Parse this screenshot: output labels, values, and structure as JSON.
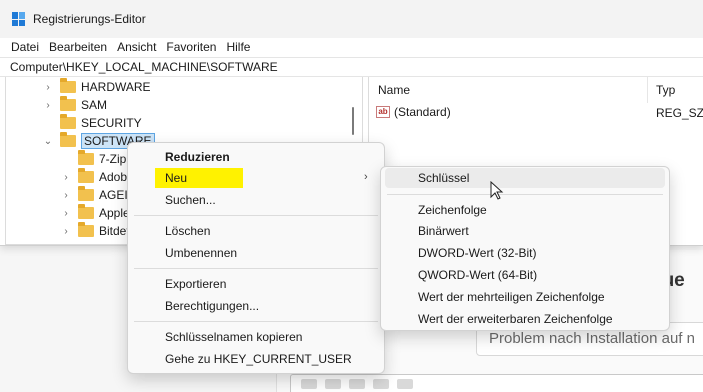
{
  "window": {
    "title": "Registrierungs-Editor",
    "menu": [
      "Datei",
      "Bearbeiten",
      "Ansicht",
      "Favoriten",
      "Hilfe"
    ],
    "address": "Computer\\HKEY_LOCAL_MACHINE\\SOFTWARE"
  },
  "tree": {
    "items": [
      {
        "label": "HARDWARE",
        "expander": "›"
      },
      {
        "label": "SAM",
        "expander": "›"
      },
      {
        "label": "SECURITY",
        "expander": ""
      },
      {
        "label": "SOFTWARE",
        "expander": "⌄",
        "selected": true
      },
      {
        "label": "7-Zip",
        "expander": ""
      },
      {
        "label": "Adobe",
        "expander": "›"
      },
      {
        "label": "AGEIA",
        "expander": "›"
      },
      {
        "label": "Apple",
        "expander": "›"
      },
      {
        "label": "Bitdef",
        "expander": "›"
      }
    ]
  },
  "values_pane": {
    "col_name": "Name",
    "col_type": "Typ",
    "rows": [
      {
        "name": "(Standard)",
        "type": "REG_SZ"
      }
    ]
  },
  "context_menu": {
    "items": [
      "Reduzieren",
      "Neu",
      "Suchen...",
      "Löschen",
      "Umbenennen",
      "Exportieren",
      "Berechtigungen...",
      "Schlüsselnamen kopieren",
      "Gehe zu HKEY_CURRENT_USER"
    ],
    "submenu_arrow": "›",
    "highlight_color": "#fff200"
  },
  "submenu": {
    "items": [
      "Schlüssel",
      "Zeichenfolge",
      "Binärwert",
      "DWORD-Wert (32-Bit)",
      "QWORD-Wert (64-Bit)",
      "Wert der mehrteiligen Zeichenfolge",
      "Wert der erweiterbaren Zeichenfolge"
    ]
  },
  "background": {
    "heading": "eue",
    "input_text": "Problem nach Installation auf n"
  }
}
